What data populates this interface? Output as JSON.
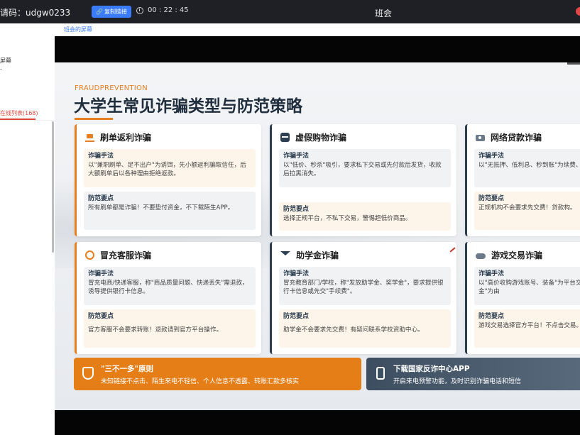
{
  "topbar": {
    "meeting_code": "请码：udgw0233",
    "copy_button": "复制链接",
    "timer": "00 : 22 : 45",
    "room_title": "班会"
  },
  "sidebar": {
    "share_label": "屏幕",
    "online_tab": "在线列表(168)"
  },
  "screen": {
    "caption": "班会的屏幕"
  },
  "slide": {
    "eyebrow": "FRAUDPREVENTION",
    "title": "大学生常见诈骗类型与防范策略",
    "cards": [
      {
        "icon": "cart-icon",
        "title": "刷单返利诈骗",
        "method_label": "诈骗手法",
        "method_text": "以\"兼职刷单、足不出户\"为诱饵，先小额返利骗取信任，后大额刷单后以各种理由拒绝返款。",
        "tip_label": "防范要点",
        "tip_text": "所有刷单都是诈骗！不要垫付资金，不下载陌生APP。"
      },
      {
        "icon": "box-icon",
        "title": "虚假购物诈骗",
        "method_label": "诈骗手法",
        "method_text": "以\"低价、秒杀\"吸引，要求私下交易或先付款后发货，收款后拉黑消失。",
        "tip_label": "防范要点",
        "tip_text": "选择正规平台，不私下交易，警惕超低价商品。"
      },
      {
        "icon": "money-icon",
        "title": "网络贷款诈骗",
        "method_label": "诈骗手法",
        "method_text": "以\"无抵押、低利息、秒到账\"为续费、保证金\"。",
        "tip_label": "防范要点",
        "tip_text": "正规机构不会要求先交费！贷款构。"
      },
      {
        "icon": "headset-icon",
        "title": "冒充客服诈骗",
        "method_label": "诈骗手法",
        "method_text": "冒充电商/快递客服，称\"商品质量问题、快递丢失\"需退款，诱导提供银行卡信息。",
        "tip_label": "防范要点",
        "tip_text": "官方客服不会要求转账！退款请到官方平台操作。"
      },
      {
        "icon": "graduation-cap-icon",
        "title": "助学金诈骗",
        "method_label": "诈骗手法",
        "method_text": "冒充教育部门/学校，称\"发放助学金、奖学金\"，要求提供银行卡信息或先交\"手续费\"。",
        "tip_label": "防范要点",
        "tip_text": "助学金不会要求先交费！有疑问联系学校资助中心。"
      },
      {
        "icon": "gamepad-icon",
        "title": "游戏交易诈骗",
        "method_label": "诈骗手法",
        "method_text": "以\"高价收购游戏账号、装备\"为平台交易，后以\"冻结资金\"为由",
        "tip_label": "防范要点",
        "tip_text": "游戏交易选择官方平台！不点击交易。"
      }
    ],
    "banners": [
      {
        "icon": "shield-icon",
        "title": "\"三不一多\"原则",
        "subtitle": "未知链接不点击、陌生来电不轻信、个人信息不透露、转账汇款多核实"
      },
      {
        "icon": "phone-icon",
        "title": "下载国家反诈中心APP",
        "subtitle": "开启来电预警功能，及时识别诈骗电话和短信"
      }
    ]
  },
  "colors": {
    "accent": "#e67e22",
    "navy": "#2c3e50",
    "link_blue": "#3b7cff",
    "online_red": "#e0453a"
  }
}
